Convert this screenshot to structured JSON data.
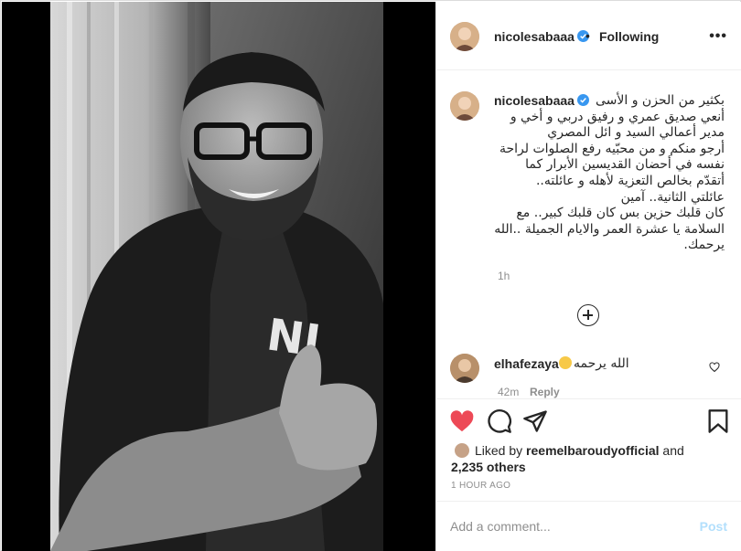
{
  "colors": {
    "verified": "#3897f0",
    "like_active": "#ed4956",
    "muted_text": "#8e8e8e",
    "post_disabled": "#b2dffc"
  },
  "post": {
    "author": "nicolesabaaa",
    "follow_status": "Following",
    "dot_separator": "•",
    "more_icon": "more-horizontal-icon"
  },
  "caption": {
    "username": "nicolesabaaa",
    "text": "بكثير من الحزن و الأسى\nأنعي صديق عمري و رفيق دربي و أخي و\nمدير أعمالي السيد و ائل المصري\nأرجو منكم و من محبّيه رفع الصلوات لراحة\nنفسه في أحضان القديسين الأبرار كما\nأتقدّم بخالص التعزية لأهله و عائلته..\nعائلتي الثانية.. آمين\nكان قلبك حزين بس كان قلبك كبير.. مع\nالسلامة يا عشرة العمر والايام الجميلة ..الله\nيرحمك.",
    "time": "1h"
  },
  "comments": [
    {
      "username": "elhafezaya",
      "text": "الله يرحمه",
      "emoji": "crying-face-emoji",
      "time": "42m",
      "reply_label": "Reply"
    }
  ],
  "likes": {
    "prefix": "Liked by ",
    "liker": "reemelbaroudyofficial",
    "conjunction": " and",
    "others": "2,235 others"
  },
  "timestamp": "1 HOUR AGO",
  "add_comment": {
    "placeholder": "Add a comment...",
    "post_label": "Post"
  }
}
